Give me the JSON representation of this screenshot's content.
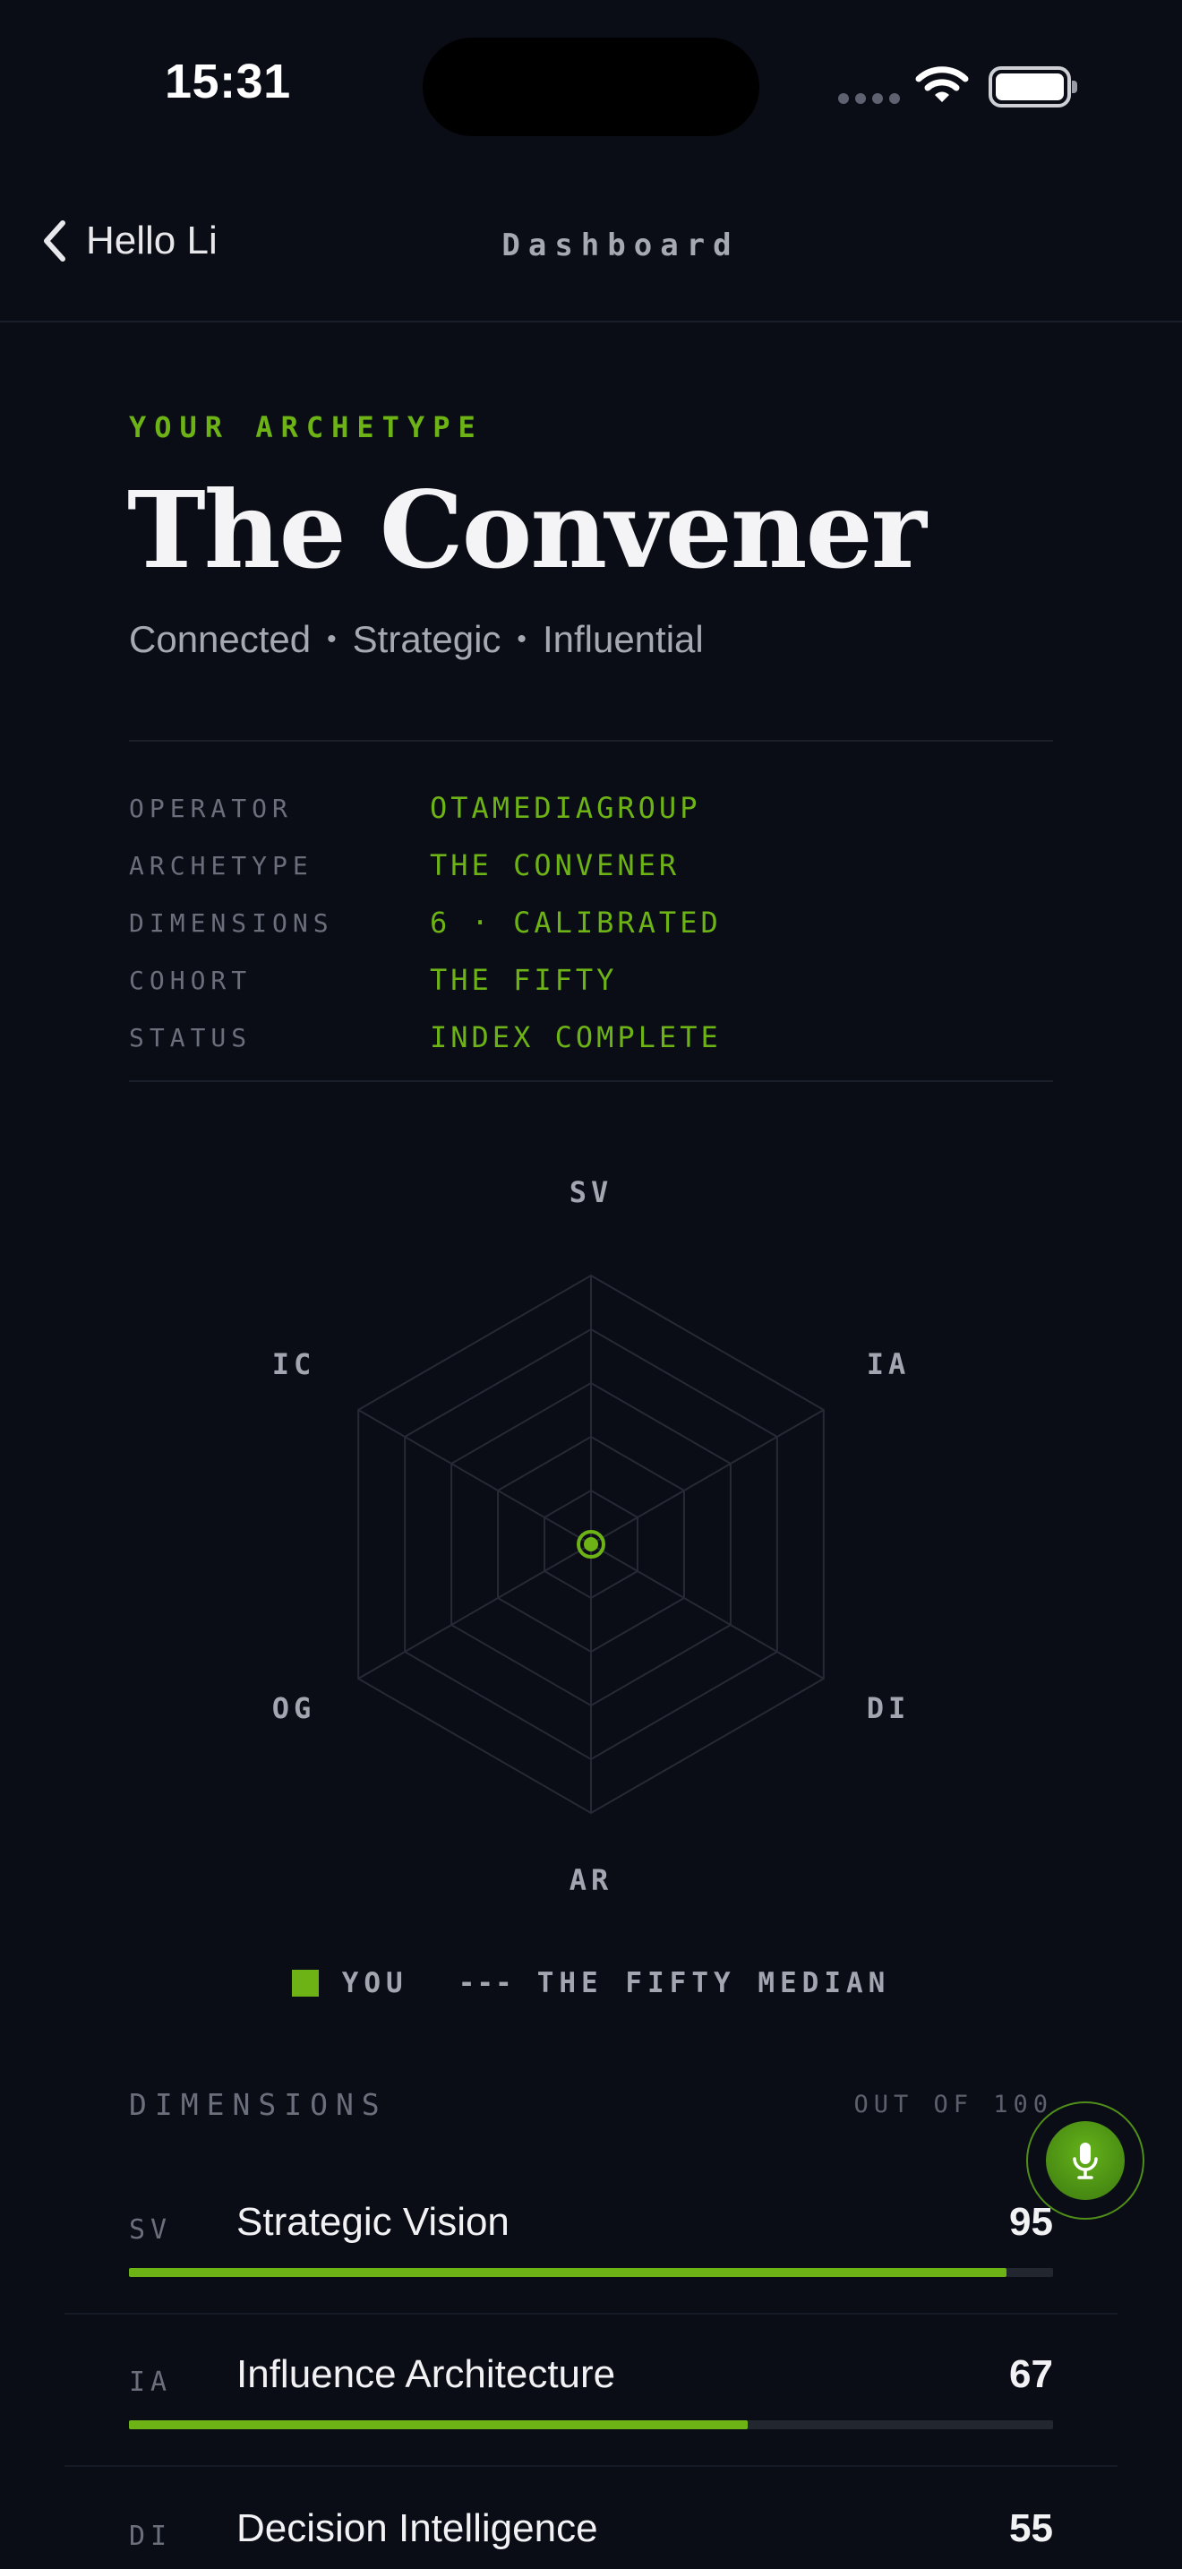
{
  "status_bar": {
    "time": "15:31"
  },
  "nav": {
    "back_label": "Hello Li",
    "title": "Dashboard"
  },
  "archetype": {
    "eyebrow": "YOUR ARCHETYPE",
    "title": "The Convener",
    "traits": [
      "Connected",
      "Strategic",
      "Influential"
    ],
    "trait_separator": "•"
  },
  "meta": [
    {
      "key": "OPERATOR",
      "value": "OTAMEDIAGROUP"
    },
    {
      "key": "ARCHETYPE",
      "value": "THE CONVENER"
    },
    {
      "key": "DIMENSIONS",
      "value": "6 · CALIBRATED"
    },
    {
      "key": "COHORT",
      "value": "THE FIFTY"
    },
    {
      "key": "STATUS",
      "value": "INDEX COMPLETE"
    }
  ],
  "radar": {
    "axes": [
      "SV",
      "IA",
      "DI",
      "AR",
      "OG",
      "IC"
    ],
    "rings": 5,
    "accent": "#6db316",
    "grid_color": "#262a35"
  },
  "legend": {
    "you": "YOU",
    "median_marker": "---",
    "median": "THE FIFTY MEDIAN"
  },
  "dimensions": {
    "heading": "DIMENSIONS",
    "scale": "OUT OF 100",
    "items": [
      {
        "code": "SV",
        "name": "Strategic Vision",
        "score": 95
      },
      {
        "code": "IA",
        "name": "Influence Architecture",
        "score": 67
      },
      {
        "code": "DI",
        "name": "Decision Intelligence",
        "score": 55
      }
    ]
  },
  "fab": {
    "icon": "microphone-icon"
  },
  "colors": {
    "background": "#0a0d16",
    "accent": "#6db316",
    "muted": "#6b6f7b"
  }
}
